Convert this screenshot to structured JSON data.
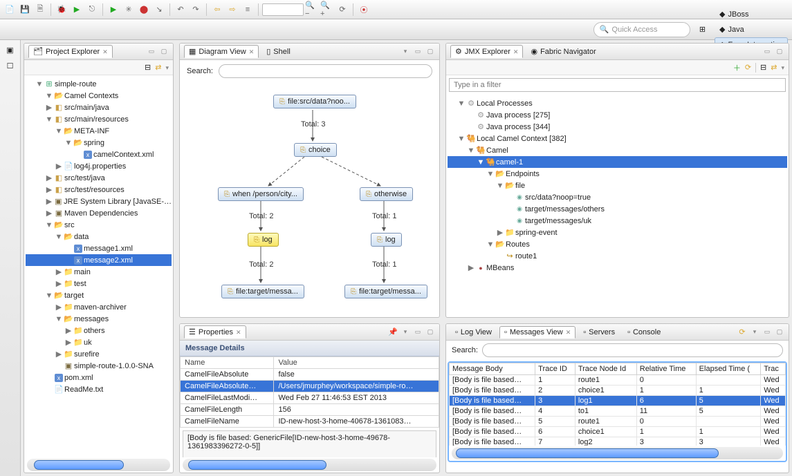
{
  "perspective": {
    "quick_access_placeholder": "Quick Access",
    "buttons": [
      "JBoss",
      "Java",
      "Fuse Integration"
    ],
    "active": "Fuse Integration"
  },
  "project_explorer": {
    "title": "Project Explorer",
    "tree": [
      {
        "d": 1,
        "ic": "proj",
        "open": true,
        "label": "simple-route"
      },
      {
        "d": 2,
        "ic": "folderop",
        "open": true,
        "label": "Camel Contexts"
      },
      {
        "d": 2,
        "ic": "pkg",
        "open": false,
        "label": "src/main/java"
      },
      {
        "d": 2,
        "ic": "pkg",
        "open": true,
        "label": "src/main/resources"
      },
      {
        "d": 3,
        "ic": "folderop",
        "open": true,
        "label": "META-INF"
      },
      {
        "d": 4,
        "ic": "folderop",
        "open": true,
        "label": "spring"
      },
      {
        "d": 5,
        "ic": "xml",
        "label": "camelContext.xml"
      },
      {
        "d": 3,
        "ic": "file",
        "open": false,
        "label": "log4j.properties"
      },
      {
        "d": 2,
        "ic": "pkg",
        "open": false,
        "label": "src/test/java"
      },
      {
        "d": 2,
        "ic": "pkg",
        "open": false,
        "label": "src/test/resources"
      },
      {
        "d": 2,
        "ic": "jar",
        "open": false,
        "label": "JRE System Library [JavaSE-…"
      },
      {
        "d": 2,
        "ic": "jar",
        "open": false,
        "label": "Maven Dependencies"
      },
      {
        "d": 2,
        "ic": "folderop",
        "open": true,
        "label": "src"
      },
      {
        "d": 3,
        "ic": "folderop",
        "open": true,
        "label": "data"
      },
      {
        "d": 4,
        "ic": "xml",
        "label": "message1.xml"
      },
      {
        "d": 4,
        "ic": "xml",
        "label": "message2.xml",
        "selected": true
      },
      {
        "d": 3,
        "ic": "folder",
        "open": false,
        "label": "main"
      },
      {
        "d": 3,
        "ic": "folder",
        "open": false,
        "label": "test"
      },
      {
        "d": 2,
        "ic": "folderop",
        "open": true,
        "label": "target"
      },
      {
        "d": 3,
        "ic": "folder",
        "open": false,
        "label": "maven-archiver"
      },
      {
        "d": 3,
        "ic": "folderop",
        "open": true,
        "label": "messages"
      },
      {
        "d": 4,
        "ic": "folder",
        "open": false,
        "label": "others"
      },
      {
        "d": 4,
        "ic": "folder",
        "open": false,
        "label": "uk"
      },
      {
        "d": 3,
        "ic": "folder",
        "open": false,
        "label": "surefire"
      },
      {
        "d": 3,
        "ic": "jar",
        "label": "simple-route-1.0.0-SNA"
      },
      {
        "d": 2,
        "ic": "xml",
        "label": "pom.xml"
      },
      {
        "d": 2,
        "ic": "file",
        "label": "ReadMe.txt"
      }
    ]
  },
  "diagram": {
    "tab_title": "Diagram View",
    "inactive_tab": "Shell",
    "search_label": "Search:",
    "nodes": {
      "file1": "file:src/data?noo...",
      "choice": "choice",
      "when": "when /person/city...",
      "otherwise": "otherwise",
      "log1": "log",
      "log2": "log",
      "fileL": "file:target/messa...",
      "fileR": "file:target/messa..."
    },
    "totals": {
      "t1": "Total: 3",
      "t2l": "Total: 2",
      "t2r": "Total: 1",
      "t3l": "Total: 2",
      "t3r": "Total: 1"
    }
  },
  "jmx": {
    "title": "JMX Explorer",
    "inactive": "Fabric Navigator",
    "filter_placeholder": "Type in a filter",
    "tree": [
      {
        "d": 1,
        "ic": "cog",
        "open": true,
        "label": "Local Processes"
      },
      {
        "d": 2,
        "ic": "cog",
        "label": "Java process [275]"
      },
      {
        "d": 2,
        "ic": "cog",
        "label": "Java process [344]"
      },
      {
        "d": 1,
        "ic": "camel",
        "open": true,
        "label": "Local Camel Context [382]"
      },
      {
        "d": 2,
        "ic": "camel",
        "open": true,
        "label": "Camel"
      },
      {
        "d": 3,
        "ic": "camel",
        "open": true,
        "label": "camel-1",
        "selected": true
      },
      {
        "d": 4,
        "ic": "folderop",
        "open": true,
        "label": "Endpoints"
      },
      {
        "d": 5,
        "ic": "folderop",
        "open": true,
        "label": "file"
      },
      {
        "d": 6,
        "ic": "ep",
        "label": "src/data?noop=true"
      },
      {
        "d": 6,
        "ic": "ep",
        "label": "target/messages/others"
      },
      {
        "d": 6,
        "ic": "ep",
        "label": "target/messages/uk"
      },
      {
        "d": 5,
        "ic": "folder",
        "open": false,
        "label": "spring-event"
      },
      {
        "d": 4,
        "ic": "folderop",
        "open": true,
        "label": "Routes"
      },
      {
        "d": 5,
        "ic": "route",
        "label": "route1"
      },
      {
        "d": 2,
        "ic": "bean",
        "open": false,
        "label": "MBeans"
      }
    ]
  },
  "properties": {
    "title": "Properties",
    "section": "Message Details",
    "cols": [
      "Name",
      "Value"
    ],
    "rows": [
      [
        "CamelFileAbsolute",
        "false"
      ],
      [
        "CamelFileAbsolute…",
        "/Users/jmurphey/workspace/simple-ro…"
      ],
      [
        "CamelFileLastModi…",
        "Wed Feb 27 11:46:53 EST 2013"
      ],
      [
        "CamelFileLength",
        "156"
      ],
      [
        "CamelFileName",
        "ID-new-host-3-home-40678-1361083…"
      ]
    ],
    "selected_row": 1,
    "body": "[Body is file based: GenericFile[ID-new-host-3-home-49678-1361983396272-0-5]]"
  },
  "bottom_tabs": {
    "tabs": [
      "Log View",
      "Messages View",
      "Servers",
      "Console"
    ],
    "active": "Messages View",
    "search_label": "Search:"
  },
  "messages": {
    "cols": [
      "Message Body",
      "Trace ID",
      "Trace Node Id",
      "Relative Time",
      "Elapsed Time (",
      "Trac"
    ],
    "rows": [
      [
        "[Body is file based…",
        "1",
        "route1",
        "0",
        "",
        "Wed"
      ],
      [
        "[Body is file based…",
        "2",
        "choice1",
        "1",
        "1",
        "Wed"
      ],
      [
        "[Body is file based…",
        "3",
        "log1",
        "6",
        "5",
        "Wed"
      ],
      [
        "[Body is file based…",
        "4",
        "to1",
        "11",
        "5",
        "Wed"
      ],
      [
        "[Body is file based…",
        "5",
        "route1",
        "0",
        "",
        "Wed"
      ],
      [
        "[Body is file based…",
        "6",
        "choice1",
        "1",
        "1",
        "Wed"
      ],
      [
        "[Body is file based…",
        "7",
        "log2",
        "3",
        "3",
        "Wed"
      ]
    ],
    "selected_row": 2
  }
}
